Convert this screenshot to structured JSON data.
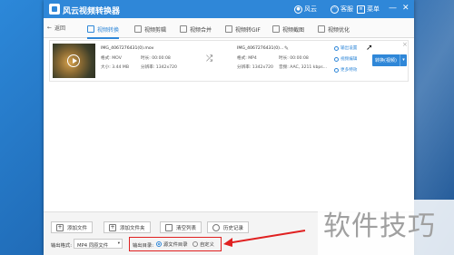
{
  "window": {
    "title": "风云视频转换器",
    "header_buttons": {
      "login": "风云",
      "vip": "客服",
      "menu": "菜单"
    },
    "window_controls": {
      "minimize": "—",
      "close": "✕"
    }
  },
  "nav": {
    "back": "返回",
    "tabs": [
      {
        "label": "视频转换",
        "active": true
      },
      {
        "label": "视频剪辑",
        "active": false
      },
      {
        "label": "视频合并",
        "active": false
      },
      {
        "label": "视频转GIF",
        "active": false
      },
      {
        "label": "视频截图",
        "active": false
      },
      {
        "label": "视频优化",
        "active": false
      }
    ]
  },
  "file": {
    "source": {
      "name": "IMG_4067276431(0).mov",
      "format": "格式: MOV",
      "duration": "时长: 00:00:08",
      "size": "大小: 3.44 MB",
      "resolution": "分辨率: 1342x720"
    },
    "output": {
      "name": "IMG_4067276431(0)...",
      "format": "格式: MP4",
      "duration": "时长: 00:00:08",
      "resolution": "分辨率: 1342x720",
      "audio": "音频: AAC, 3211 kbps..."
    },
    "options": {
      "settings": "输出设置",
      "edit": "视频编辑",
      "effects": "更多特效"
    },
    "convert_button": "转换(视频)",
    "close": "×"
  },
  "bottom": {
    "buttons": [
      "添加文件",
      "添加文件夹",
      "清空列表",
      "历史记录"
    ],
    "output_format_label": "输出格式:",
    "output_format_value": "MP4 同原文件",
    "output_dir_label": "输出目录:",
    "radio_options": [
      {
        "label": "源文件目录",
        "checked": true
      },
      {
        "label": "自定义",
        "checked": false
      }
    ]
  },
  "watermark": "软件技巧",
  "colors": {
    "accent": "#2f87d8",
    "annotation": "#e02020"
  }
}
